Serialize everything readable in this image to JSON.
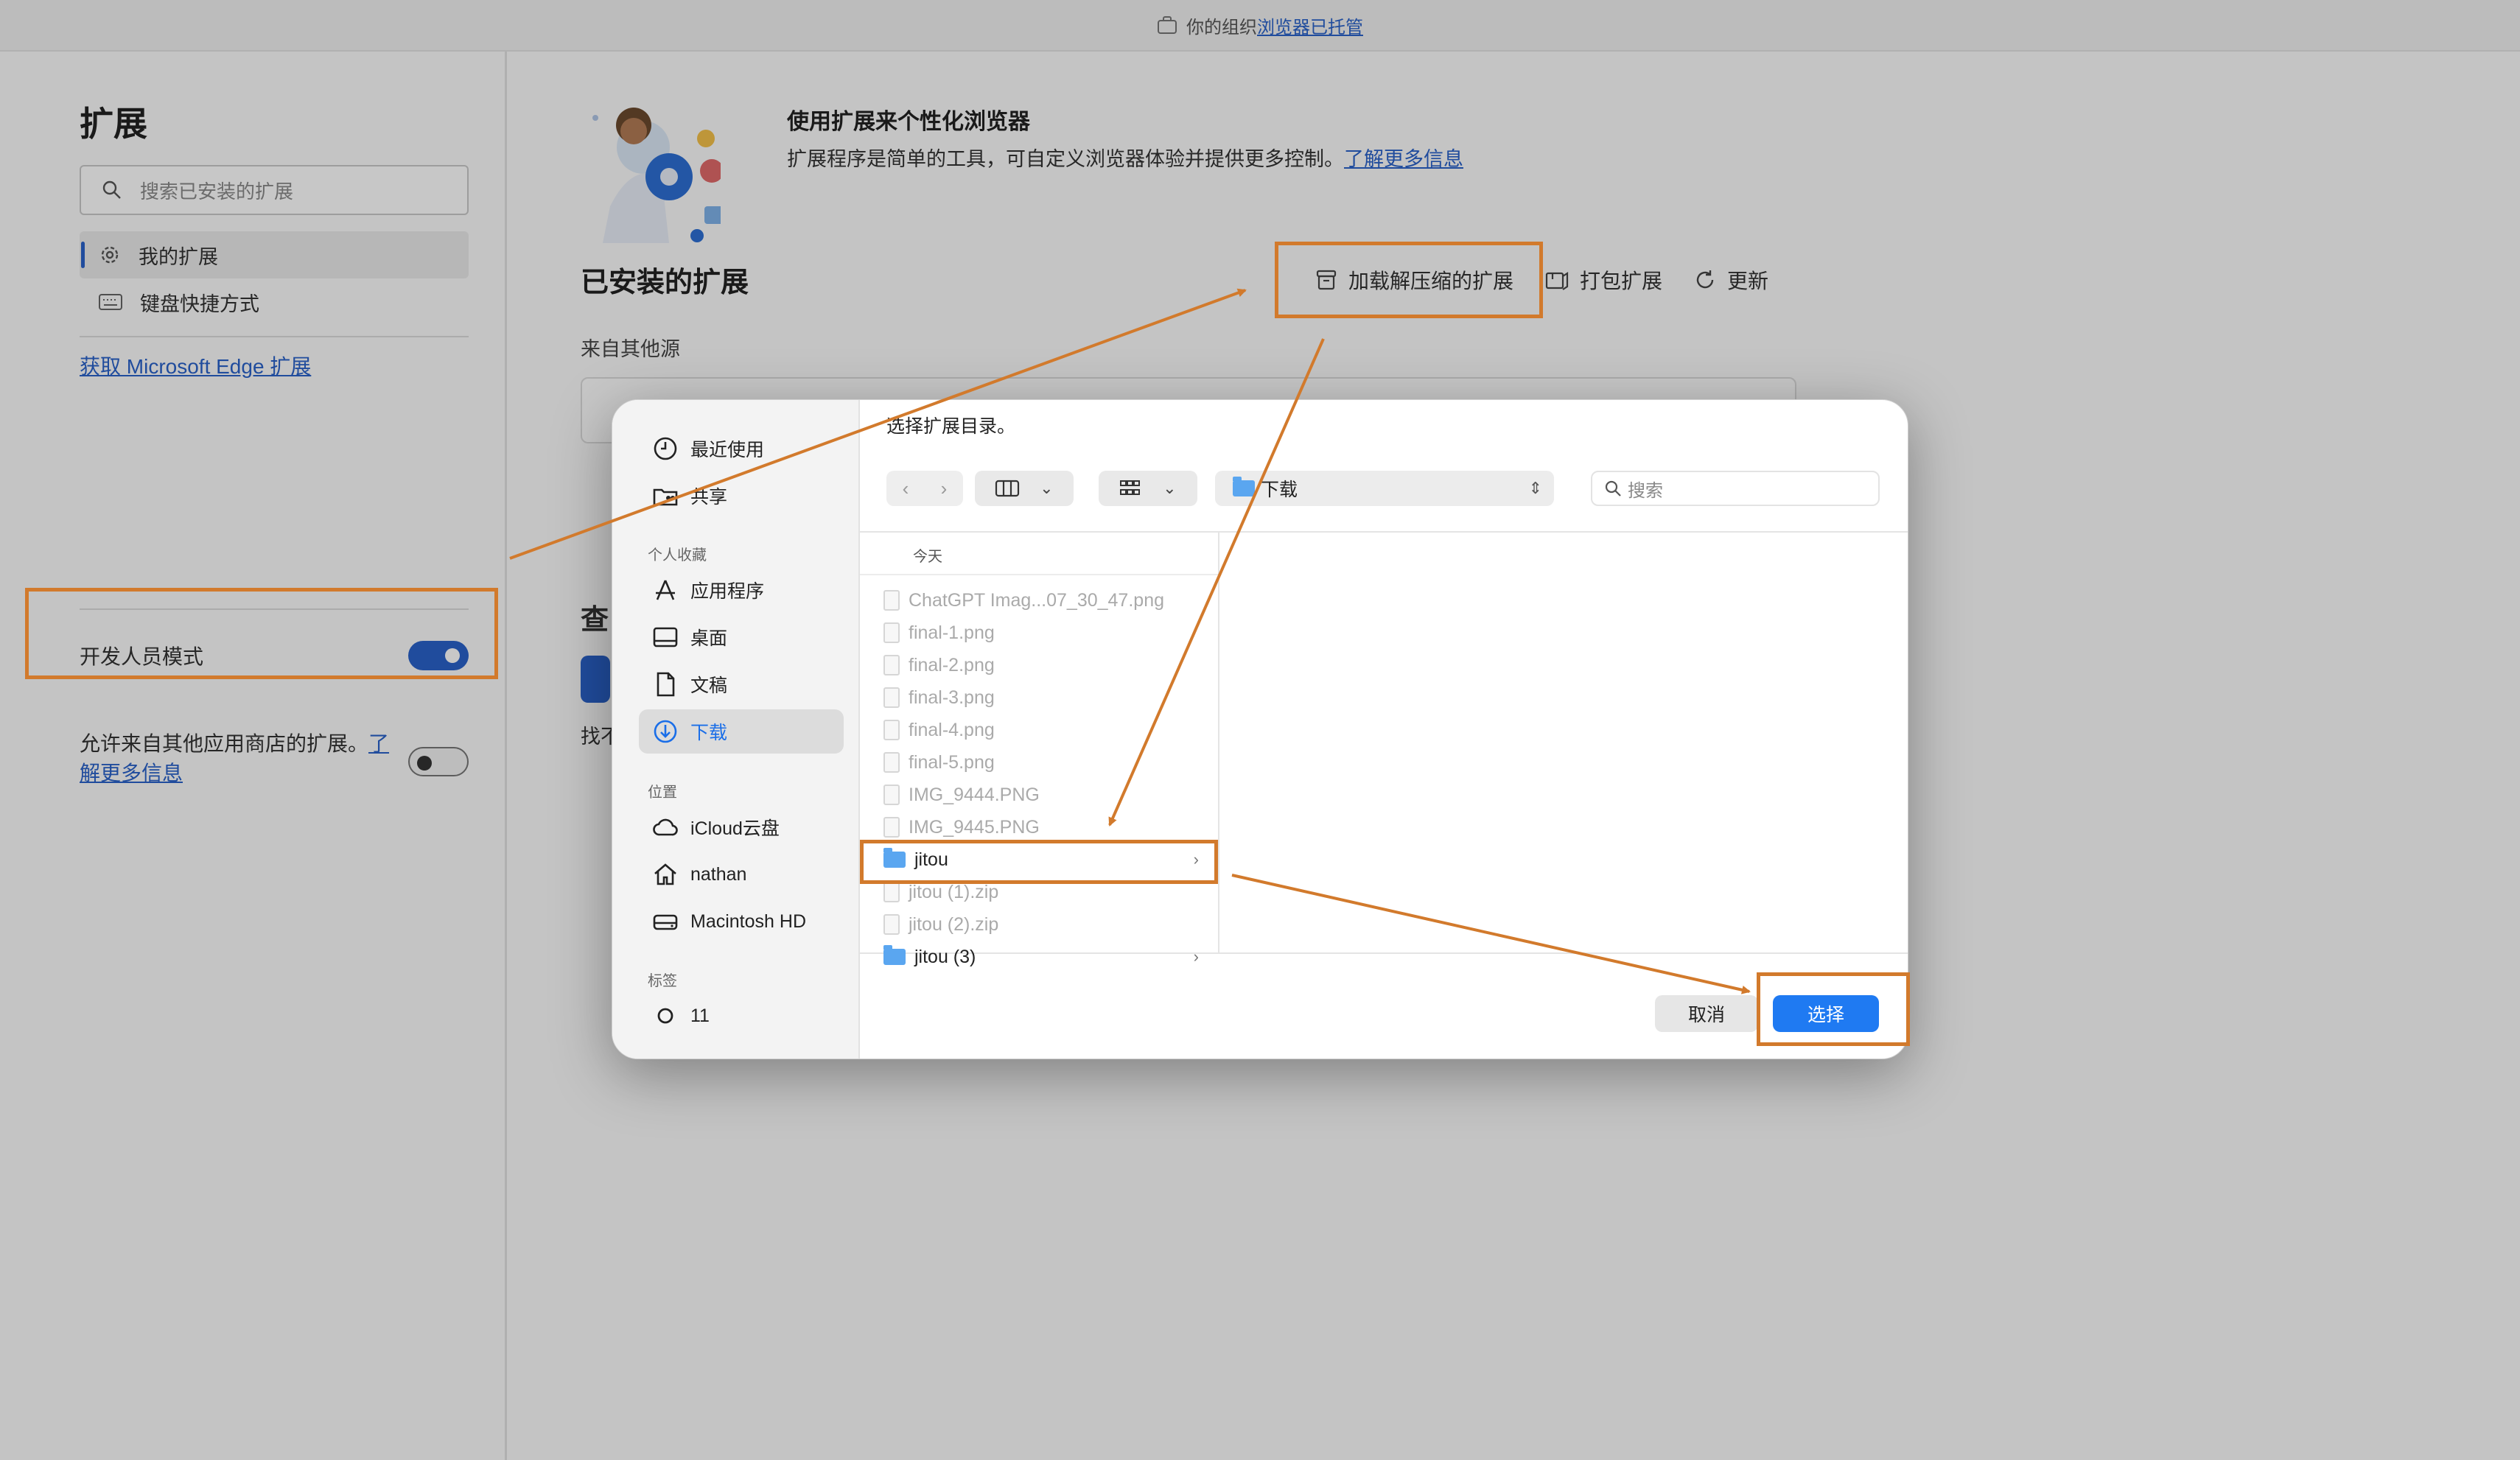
{
  "topbar": {
    "prefix": "你的组织",
    "link": "浏览器已托管"
  },
  "sidebar": {
    "title": "扩展",
    "search_placeholder": "搜索已安装的扩展",
    "items": [
      {
        "label": "我的扩展",
        "icon": "gear-icon",
        "active": true
      },
      {
        "label": "键盘快捷方式",
        "icon": "keyboard-icon",
        "active": false
      }
    ],
    "get_link": "获取 Microsoft Edge 扩展",
    "dev_mode_label": "开发人员模式",
    "dev_mode_on": true,
    "allow_text": "允许来自其他应用商店的扩展。",
    "allow_link": "了解更多信息",
    "allow_on": false
  },
  "main": {
    "hero_title": "使用扩展来个性化浏览器",
    "hero_desc": "扩展程序是简单的工具，可自定义浏览器体验并提供更多控制。",
    "hero_link": "了解更多信息",
    "installed_title": "已安装的扩展",
    "actions": {
      "load": "加载解压缩的扩展",
      "pack": "打包扩展",
      "update": "更新"
    },
    "source_label": "来自其他源",
    "ghost_1": "查",
    "ghost_2": "找不"
  },
  "dialog": {
    "title": "选择扩展目录。",
    "sidebar": {
      "items_top": [
        {
          "label": "最近使用",
          "icon": "clock-icon"
        },
        {
          "label": "共享",
          "icon": "shared-folder-icon"
        }
      ],
      "section_favorites": "个人收藏",
      "favorites": [
        {
          "label": "应用程序",
          "icon": "apps-icon"
        },
        {
          "label": "桌面",
          "icon": "desktop-icon"
        },
        {
          "label": "文稿",
          "icon": "document-icon"
        },
        {
          "label": "下载",
          "icon": "download-icon",
          "active": true
        }
      ],
      "section_locations": "位置",
      "locations": [
        {
          "label": "iCloud云盘",
          "icon": "cloud-icon"
        },
        {
          "label": "nathan",
          "icon": "home-icon"
        },
        {
          "label": "Macintosh HD",
          "icon": "disk-icon"
        }
      ],
      "section_tags": "标签",
      "tags": [
        {
          "label": "11",
          "icon": "tag-circle-icon"
        }
      ]
    },
    "path": "下载",
    "search_placeholder": "搜索",
    "column_header": "今天",
    "files": [
      {
        "name": "ChatGPT Imag...07_30_47.png",
        "type": "file"
      },
      {
        "name": "final-1.png",
        "type": "file"
      },
      {
        "name": "final-2.png",
        "type": "file"
      },
      {
        "name": "final-3.png",
        "type": "file"
      },
      {
        "name": "final-4.png",
        "type": "file"
      },
      {
        "name": "final-5.png",
        "type": "file"
      },
      {
        "name": "IMG_9444.PNG",
        "type": "file"
      },
      {
        "name": "IMG_9445.PNG",
        "type": "file"
      },
      {
        "name": "jitou",
        "type": "folder",
        "selected": true
      },
      {
        "name": "jitou (1).zip",
        "type": "file"
      },
      {
        "name": "jitou (2).zip",
        "type": "file"
      },
      {
        "name": "jitou (3)",
        "type": "folder"
      }
    ],
    "cancel": "取消",
    "choose": "选择"
  },
  "colors": {
    "accent": "#2a62c9",
    "annotation": "#d27a2c",
    "choose_button": "#1f7af2"
  }
}
